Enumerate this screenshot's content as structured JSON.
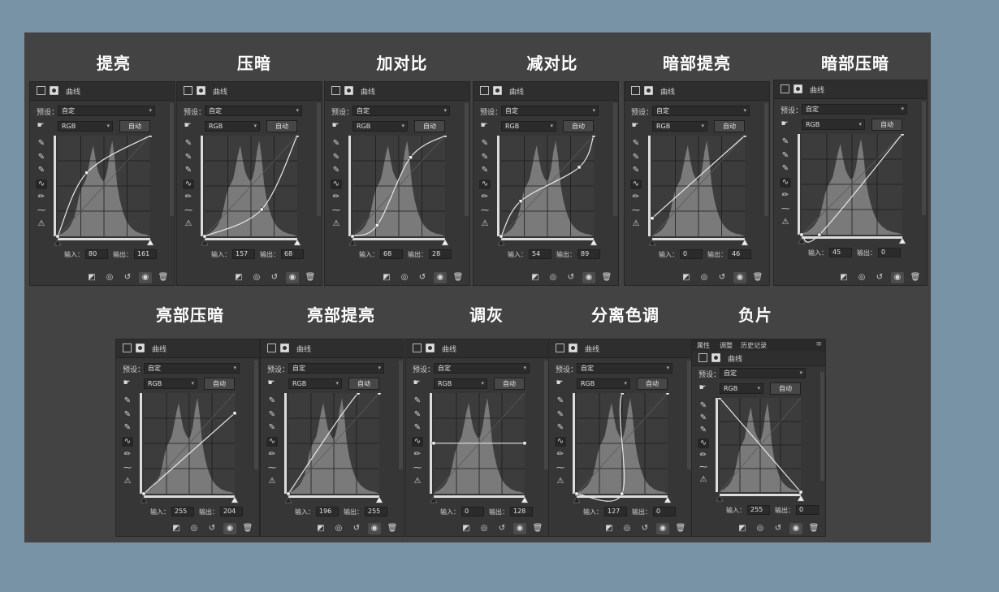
{
  "labels": {
    "header_title": "曲线",
    "preset_label": "预设：",
    "preset_value": "自定",
    "channel_value": "RGB",
    "auto_button": "自动",
    "input_label": "输入：",
    "output_label": "输出：",
    "tab_properties": "属性",
    "tab_adjust": "调整",
    "tab_history": "历史记录"
  },
  "colors": {
    "page_bg": "#7893a6",
    "board_bg": "#434343",
    "panel_bg": "#363636",
    "graph_bg": "#3c3c3c",
    "histogram": "#7a7a7a",
    "curve": "#e8e8e8"
  },
  "icons": {
    "tools": [
      "sample-image-icon",
      "black-point-eyedropper-icon",
      "gray-point-eyedropper-icon",
      "white-point-eyedropper-icon",
      "curve-points-icon",
      "pencil-icon",
      "smooth-icon",
      "clipping-warning-icon"
    ],
    "footer": [
      "clip-to-layer-icon",
      "view-previous-icon",
      "reset-icon",
      "visibility-eye-icon",
      "delete-icon"
    ]
  },
  "panels": [
    {
      "title": "提亮",
      "input": "80",
      "output": "161",
      "curve": [
        [
          0,
          0
        ],
        [
          80,
          161
        ],
        [
          255,
          255
        ]
      ]
    },
    {
      "title": "压暗",
      "input": "157",
      "output": "68",
      "curve": [
        [
          0,
          0
        ],
        [
          157,
          68
        ],
        [
          255,
          255
        ]
      ]
    },
    {
      "title": "加对比",
      "input": "68",
      "output": "28",
      "curve": [
        [
          0,
          0
        ],
        [
          68,
          28
        ],
        [
          160,
          200
        ],
        [
          255,
          255
        ]
      ]
    },
    {
      "title": "减对比",
      "input": "54",
      "output": "89",
      "curve": [
        [
          0,
          0
        ],
        [
          54,
          89
        ],
        [
          215,
          175
        ],
        [
          255,
          255
        ]
      ]
    },
    {
      "title": "暗部提亮",
      "input": "0",
      "output": "46",
      "curve": [
        [
          0,
          46
        ],
        [
          255,
          255
        ]
      ]
    },
    {
      "title": "暗部压暗",
      "input": "45",
      "output": "0",
      "curve": [
        [
          0,
          0
        ],
        [
          45,
          0
        ],
        [
          255,
          255
        ]
      ]
    },
    {
      "title": "亮部压暗",
      "input": "255",
      "output": "204",
      "curve": [
        [
          0,
          0
        ],
        [
          255,
          204
        ]
      ]
    },
    {
      "title": "亮部提亮",
      "input": "196",
      "output": "255",
      "curve": [
        [
          0,
          0
        ],
        [
          196,
          255
        ],
        [
          255,
          255
        ]
      ]
    },
    {
      "title": "调灰",
      "input": "0",
      "output": "128",
      "curve": [
        [
          0,
          128
        ],
        [
          255,
          128
        ]
      ]
    },
    {
      "title": "分离色调",
      "input": "127",
      "output": "0",
      "curve": [
        [
          0,
          0
        ],
        [
          127,
          0
        ],
        [
          128,
          255
        ],
        [
          255,
          255
        ]
      ]
    },
    {
      "title": "负片",
      "input": "255",
      "output": "0",
      "curve": [
        [
          0,
          255
        ],
        [
          255,
          0
        ]
      ]
    }
  ]
}
